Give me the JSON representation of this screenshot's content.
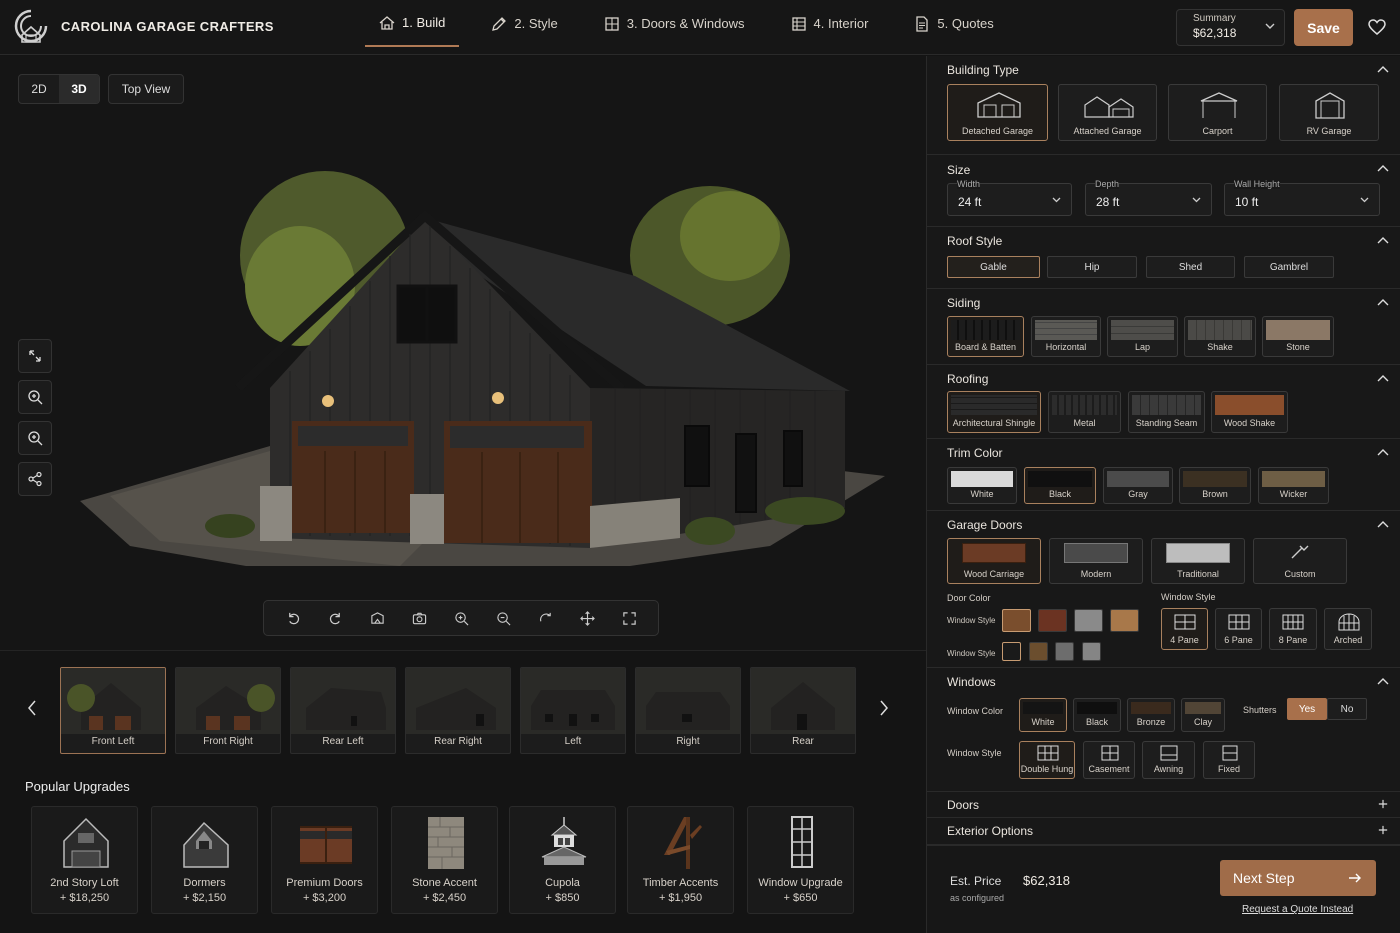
{
  "app": {
    "brand": "CAROLINA GARAGE CRAFTERS"
  },
  "nav": {
    "tabs": [
      {
        "label": "1. Build",
        "icon": "home-icon"
      },
      {
        "label": "2. Style",
        "icon": "pencil-icon"
      },
      {
        "label": "3. Doors & Windows",
        "icon": "window-icon"
      },
      {
        "label": "4. Interior",
        "icon": "interior-icon"
      },
      {
        "label": "5. Quotes",
        "icon": "document-icon"
      }
    ],
    "active_tab": "1. Build"
  },
  "header": {
    "summary_label": "Summary",
    "summary_price": "$62,318",
    "save_label": "Save"
  },
  "viewer": {
    "view_modes": [
      "2D",
      "3D"
    ],
    "active_view": "3D",
    "top_view_label": "Top View",
    "side_tools": [
      "rotate-expand-icon",
      "zoom-in-icon",
      "zoom-in-icon",
      "share-icon"
    ],
    "toolbar": [
      "undo-icon",
      "redo-icon",
      "photo-icon",
      "camera-icon",
      "zoom-in-icon",
      "zoom-out-icon",
      "rotate-icon",
      "move-icon",
      "fullscreen-icon"
    ]
  },
  "thumbnails": {
    "items": [
      "Front Left",
      "Front Right",
      "Rear Left",
      "Rear Right",
      "Left",
      "Right",
      "Rear"
    ],
    "active": "Front Left"
  },
  "upgrades": {
    "title": "Popular Upgrades",
    "items": [
      {
        "name": "2nd Story Loft",
        "price": "+ $18,250"
      },
      {
        "name": "Dormers",
        "price": "+ $2,150"
      },
      {
        "name": "Premium Doors",
        "price": "+ $3,200"
      },
      {
        "name": "Stone Accent",
        "price": "+ $2,450"
      },
      {
        "name": "Cupola",
        "price": "+ $850"
      },
      {
        "name": "Timber Accents",
        "price": "+ $1,950"
      },
      {
        "name": "Window Upgrade",
        "price": "+ $650"
      }
    ]
  },
  "panel": {
    "building_type": {
      "title": "Building Type",
      "options": [
        "Detached Garage",
        "Attached Garage",
        "Carport",
        "RV Garage"
      ],
      "selected": "Detached Garage"
    },
    "size": {
      "title": "Size",
      "fields": [
        {
          "label": "Width",
          "value": "24 ft"
        },
        {
          "label": "Depth",
          "value": "28 ft"
        },
        {
          "label": "Wall Height",
          "value": "10 ft"
        }
      ]
    },
    "roof_style": {
      "title": "Roof Style",
      "options": [
        "Gable",
        "Hip",
        "Shed",
        "Gambrel"
      ],
      "selected": "Gable"
    },
    "siding": {
      "title": "Siding",
      "options": [
        "Board & Batten",
        "Horizontal",
        "Lap",
        "Shake",
        "Stone"
      ],
      "selected": "Board & Batten"
    },
    "roofing": {
      "title": "Roofing",
      "options": [
        "Architectural Shingle",
        "Metal",
        "Standing Seam",
        "Wood Shake"
      ],
      "selected": "Architectural Shingle"
    },
    "trim_color": {
      "title": "Trim Color",
      "options": [
        "White",
        "Black",
        "Gray",
        "Brown",
        "Wicker"
      ],
      "selected": "Black",
      "colors": [
        "#d9d9d9",
        "#101010",
        "#4b4b4b",
        "#3b3022",
        "#6e5e45"
      ]
    },
    "garage_doors": {
      "title": "Garage Doors",
      "options": [
        "Wood Carriage",
        "Modern",
        "Traditional",
        "Custom"
      ],
      "selected": "Wood Carriage",
      "door_color_label": "Door Color",
      "row_label_1": "Window Style",
      "row_label_2": "Window Style",
      "door_colors": [
        "#7a4e2d",
        "#6b3322",
        "#8a8a8a",
        "#a8784a"
      ],
      "window_colors": [
        "#1a1a1a",
        "#6b4e2e",
        "#6d6d6d",
        "#858585"
      ],
      "window_style_label": "Window Style",
      "window_styles": [
        "4 Pane",
        "6 Pane",
        "8 Pane",
        "Arched"
      ],
      "window_style_selected": "4 Pane"
    },
    "windows": {
      "title": "Windows",
      "color_label": "Window Color",
      "colors": [
        "White",
        "Black",
        "Bronze",
        "Clay"
      ],
      "color_swatches": [
        "#141414",
        "#0f0f0f",
        "#3a2a1d",
        "#514536"
      ],
      "selected_color": "White",
      "shutters_label": "Shutters",
      "shutters_yes": "Yes",
      "shutters_no": "No",
      "style_label": "Window Style",
      "styles": [
        "Double Hung",
        "Casement",
        "Awning",
        "Fixed"
      ],
      "selected_style": "Double Hung"
    },
    "doors": {
      "title": "Doors"
    },
    "exterior": {
      "title": "Exterior Options"
    }
  },
  "bottom": {
    "est_label": "Est. Price",
    "est_price": "$62,318",
    "est_sub": "as configured",
    "next_label": "Next Step",
    "quote_link": "Request a Quote Instead"
  },
  "colors": {
    "accent": "#a8704b",
    "background": "#141414",
    "panel": "#181818"
  }
}
